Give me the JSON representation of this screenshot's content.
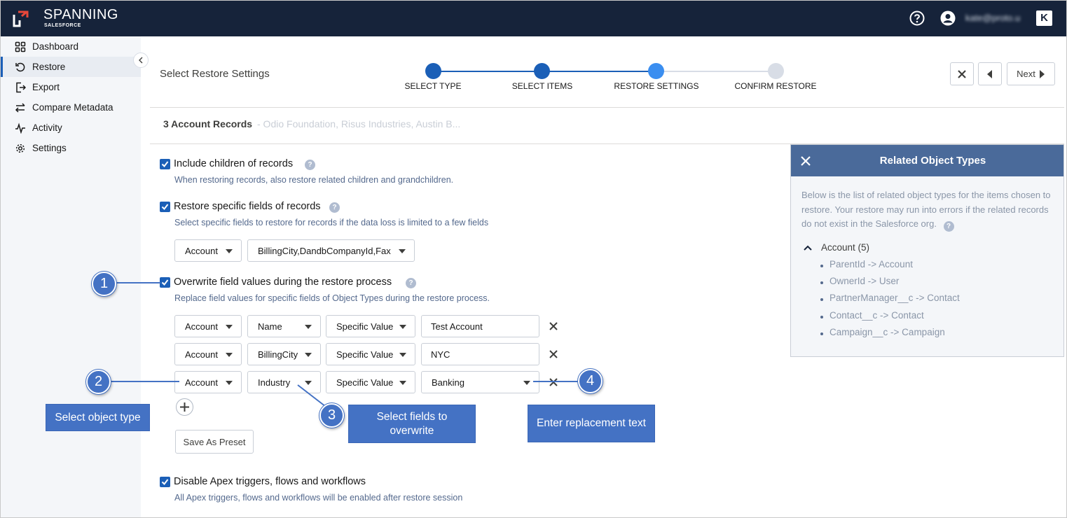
{
  "header": {
    "brand": "SPANNING",
    "brand_sub": "SALESFORCE",
    "user_email": "kate@proto.u"
  },
  "sidebar": {
    "items": [
      {
        "label": "Dashboard",
        "icon": "grid-icon"
      },
      {
        "label": "Restore",
        "icon": "restore-icon",
        "active": true
      },
      {
        "label": "Export",
        "icon": "export-icon"
      },
      {
        "label": "Compare Metadata",
        "icon": "compare-icon"
      },
      {
        "label": "Activity",
        "icon": "activity-icon"
      },
      {
        "label": "Settings",
        "icon": "gear-icon"
      }
    ]
  },
  "page": {
    "title": "Select Restore Settings",
    "steps": [
      {
        "label": "SELECT TYPE",
        "state": "done"
      },
      {
        "label": "SELECT ITEMS",
        "state": "done"
      },
      {
        "label": "RESTORE SETTINGS",
        "state": "current"
      },
      {
        "label": "CONFIRM RESTORE",
        "state": "pending"
      }
    ],
    "next_label": "Next",
    "records_title": "3 Account Records",
    "records_sub": "- Odio Foundation, Risus Industries, Austin B..."
  },
  "options": {
    "include_children": {
      "title": "Include children of records",
      "desc": "When restoring records, also restore related children and grandchildren.",
      "checked": true
    },
    "specific_fields": {
      "title": "Restore specific fields of records",
      "desc": "Select specific fields to restore for records if the data loss is limited to a few fields",
      "checked": true,
      "object": "Account",
      "fields": "BillingCity,DandbCompanyId,Fax"
    },
    "overwrite": {
      "title": "Overwrite field values during the restore process",
      "desc": "Replace field values for specific fields of Object Types during the restore process.",
      "checked": true,
      "rows": [
        {
          "object": "Account",
          "field": "Name",
          "mode": "Specific Value",
          "value": "Test Account"
        },
        {
          "object": "Account",
          "field": "BillingCity",
          "mode": "Specific Value",
          "value": "NYC"
        },
        {
          "object": "Account",
          "field": "Industry",
          "mode": "Specific Value",
          "value": "Banking"
        }
      ],
      "save_preset": "Save As Preset"
    },
    "disable_apex": {
      "title": "Disable Apex triggers, flows and workflows",
      "desc": "All Apex triggers, flows and workflows will be enabled after restore session",
      "checked": true
    },
    "help_mark": "?"
  },
  "related_panel": {
    "title": "Related Object Types",
    "text": "Below is the list of related object types for the items chosen to restore. Your restore may run into errors if the related records do not exist in the Salesforce org.",
    "group": "Account (5)",
    "items": [
      "ParentId -> Account",
      "OwnerId -> User",
      "PartnerManager__c -> Contact",
      "Contact__c -> Contact",
      "Campaign__c -> Campaign"
    ]
  },
  "callouts": {
    "n1": "1",
    "n2": "2",
    "n3": "3",
    "n4": "4",
    "object_type": "Select object type",
    "fields": "Select fields to overwrite",
    "replacement": "Enter replacement text"
  },
  "colors": {
    "topbar": "#16233a",
    "accent": "#1b5fb7",
    "step_current": "#3b8ef0",
    "step_pending": "#d8dde6",
    "panel_header": "#4a6a9a",
    "callout": "#4472c4"
  }
}
